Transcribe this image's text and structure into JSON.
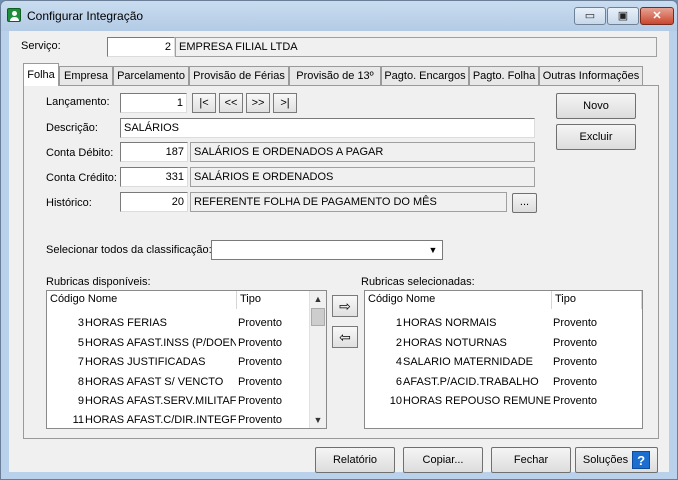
{
  "window": {
    "title": "Configurar Integração",
    "minimize": "▭",
    "maximize": "▣",
    "close": "✕"
  },
  "servico": {
    "label": "Serviço:",
    "code": "2",
    "name": "EMPRESA FILIAL LTDA"
  },
  "tabs": [
    "Folha",
    "Empresa",
    "Parcelamento",
    "Provisão de Férias",
    "Provisão de 13º",
    "Pagto. Encargos",
    "Pagto. Folha",
    "Outras Informações"
  ],
  "form": {
    "lancamento_label": "Lançamento:",
    "lancamento_value": "1",
    "nav": [
      "|<",
      "<<",
      ">>",
      ">|"
    ],
    "descricao_label": "Descrição:",
    "descricao_value": "SALÁRIOS",
    "debito_label": "Conta Débito:",
    "debito_code": "187",
    "debito_name": "SALÁRIOS E ORDENADOS A PAGAR",
    "credito_label": "Conta Crédito:",
    "credito_code": "331",
    "credito_name": "SALÁRIOS E ORDENADOS",
    "historico_label": "Histórico:",
    "historico_code": "20",
    "historico_name": "REFERENTE FOLHA DE PAGAMENTO DO MÊS",
    "historico_browse": "...",
    "novo": "Novo",
    "excluir": "Excluir",
    "selecionar_label": "Selecionar todos da classificação:",
    "selecionar_value": ""
  },
  "disponiveis": {
    "label": "Rubricas disponíveis:",
    "headers": {
      "codigo": "Código",
      "nome": "Nome",
      "tipo": "Tipo"
    },
    "rows": [
      {
        "codigo": "3",
        "nome": "HORAS FERIAS",
        "tipo": "Provento"
      },
      {
        "codigo": "5",
        "nome": "HORAS AFAST.INSS (P/DOEN",
        "tipo": "Provento"
      },
      {
        "codigo": "7",
        "nome": "HORAS JUSTIFICADAS",
        "tipo": "Provento"
      },
      {
        "codigo": "8",
        "nome": "HORAS AFAST S/ VENCTO",
        "tipo": "Provento"
      },
      {
        "codigo": "9",
        "nome": "HORAS AFAST.SERV.MILITAF",
        "tipo": "Provento"
      },
      {
        "codigo": "11",
        "nome": "HORAS AFAST.C/DIR.INTEGF",
        "tipo": "Provento"
      }
    ]
  },
  "selecionadas": {
    "label": "Rubricas selecionadas:",
    "headers": {
      "codigo": "Código",
      "nome": "Nome",
      "tipo": "Tipo"
    },
    "rows": [
      {
        "codigo": "1",
        "nome": "HORAS NORMAIS",
        "tipo": "Provento"
      },
      {
        "codigo": "2",
        "nome": "HORAS NOTURNAS",
        "tipo": "Provento"
      },
      {
        "codigo": "4",
        "nome": "SALARIO MATERNIDADE",
        "tipo": "Provento"
      },
      {
        "codigo": "6",
        "nome": "AFAST.P/ACID.TRABALHO",
        "tipo": "Provento"
      },
      {
        "codigo": "10",
        "nome": "HORAS REPOUSO REMUNEF",
        "tipo": "Provento"
      }
    ]
  },
  "transfer": {
    "add": "⇨",
    "remove": "⇦"
  },
  "footer": {
    "relatorio": "Relatório",
    "copiar": "Copiar...",
    "fechar": "Fechar",
    "solucoes": "Soluções",
    "help": "?"
  }
}
